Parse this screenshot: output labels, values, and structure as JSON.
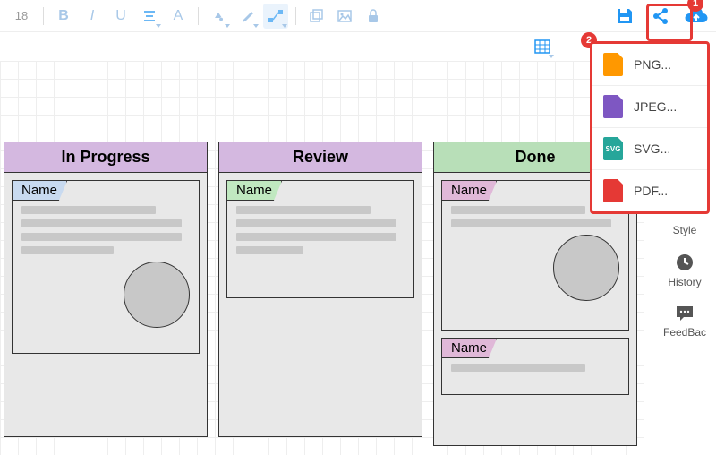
{
  "toolbar": {
    "font_size": "18"
  },
  "kanban": {
    "columns": [
      {
        "title": "In Progress",
        "header_color": "purple",
        "cards": [
          {
            "tag_label": "Name",
            "tag_color": "blue",
            "lines": 4,
            "has_circle": true
          }
        ]
      },
      {
        "title": "Review",
        "header_color": "purple",
        "cards": [
          {
            "tag_label": "Name",
            "tag_color": "green",
            "lines": 4,
            "has_circle": false
          }
        ]
      },
      {
        "title": "Done",
        "header_color": "green",
        "cards": [
          {
            "tag_label": "Name",
            "tag_color": "pink",
            "lines": 2,
            "has_circle": true
          },
          {
            "tag_label": "Name",
            "tag_color": "pink",
            "lines": 1,
            "has_circle": false
          }
        ]
      }
    ]
  },
  "export_menu": {
    "items": [
      {
        "label": "PNG...",
        "icon": "png",
        "color": "#ff9800"
      },
      {
        "label": "JPEG...",
        "icon": "jpeg",
        "color": "#7e57c2"
      },
      {
        "label": "SVG...",
        "icon": "svg",
        "color": "#26a69a"
      },
      {
        "label": "PDF...",
        "icon": "pdf",
        "color": "#e53935"
      }
    ]
  },
  "right_panel": {
    "style": "Style",
    "history": "History",
    "feedback": "FeedBac"
  },
  "annotations": {
    "badge1": "1",
    "badge2": "2"
  }
}
